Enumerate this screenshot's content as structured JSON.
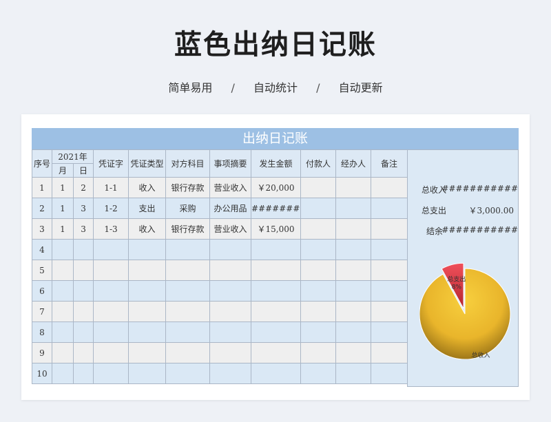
{
  "page": {
    "title": "蓝色出纳日记账",
    "subtitle_items": [
      "简单易用",
      "自动统计",
      "自动更新"
    ],
    "subtitle_sep": "/"
  },
  "sheet": {
    "banner": "出纳日记账",
    "headers": {
      "seq": "序号",
      "year": "2021年",
      "month": "月",
      "day": "日",
      "voucher_no": "凭证字",
      "voucher_type": "凭证类型",
      "account": "对方科目",
      "summary": "事项摘要",
      "amount": "发生金额",
      "payer": "付款人",
      "handler": "经办人",
      "remark": "备注"
    },
    "rows": [
      {
        "seq": "1",
        "month": "1",
        "day": "2",
        "voucher_no": "1-1",
        "voucher_type": "收入",
        "account": "银行存款",
        "summary": "营业收入",
        "amount": "￥20,000",
        "payer": "",
        "handler": "",
        "remark": ""
      },
      {
        "seq": "2",
        "month": "1",
        "day": "3",
        "voucher_no": "1-2",
        "voucher_type": "支出",
        "account": "采购",
        "summary": "办公用品",
        "amount": "##########",
        "payer": "",
        "handler": "",
        "remark": ""
      },
      {
        "seq": "3",
        "month": "1",
        "day": "3",
        "voucher_no": "1-3",
        "voucher_type": "收入",
        "account": "银行存款",
        "summary": "营业收入",
        "amount": "￥15,000",
        "payer": "",
        "handler": "",
        "remark": ""
      },
      {
        "seq": "4",
        "month": "",
        "day": "",
        "voucher_no": "",
        "voucher_type": "",
        "account": "",
        "summary": "",
        "amount": "",
        "payer": "",
        "handler": "",
        "remark": ""
      },
      {
        "seq": "5",
        "month": "",
        "day": "",
        "voucher_no": "",
        "voucher_type": "",
        "account": "",
        "summary": "",
        "amount": "",
        "payer": "",
        "handler": "",
        "remark": ""
      },
      {
        "seq": "6",
        "month": "",
        "day": "",
        "voucher_no": "",
        "voucher_type": "",
        "account": "",
        "summary": "",
        "amount": "",
        "payer": "",
        "handler": "",
        "remark": ""
      },
      {
        "seq": "7",
        "month": "",
        "day": "",
        "voucher_no": "",
        "voucher_type": "",
        "account": "",
        "summary": "",
        "amount": "",
        "payer": "",
        "handler": "",
        "remark": ""
      },
      {
        "seq": "8",
        "month": "",
        "day": "",
        "voucher_no": "",
        "voucher_type": "",
        "account": "",
        "summary": "",
        "amount": "",
        "payer": "",
        "handler": "",
        "remark": ""
      },
      {
        "seq": "9",
        "month": "",
        "day": "",
        "voucher_no": "",
        "voucher_type": "",
        "account": "",
        "summary": "",
        "amount": "",
        "payer": "",
        "handler": "",
        "remark": ""
      },
      {
        "seq": "10",
        "month": "",
        "day": "",
        "voucher_no": "",
        "voucher_type": "",
        "account": "",
        "summary": "",
        "amount": "",
        "payer": "",
        "handler": "",
        "remark": ""
      }
    ]
  },
  "summary": {
    "total_income_label": "总收入",
    "total_income_value": "###########",
    "total_expense_label": "总支出",
    "total_expense_value": "￥3,000.00",
    "balance_label": "结余",
    "balance_value": "###########"
  },
  "chart_data": {
    "type": "pie",
    "slices": [
      {
        "label": "总收入",
        "percent": 92,
        "pct_label": "92%",
        "color": "#f5c533"
      },
      {
        "label": "总支出",
        "percent": 8,
        "pct_label": "8%",
        "color": "#e0404a"
      }
    ]
  }
}
